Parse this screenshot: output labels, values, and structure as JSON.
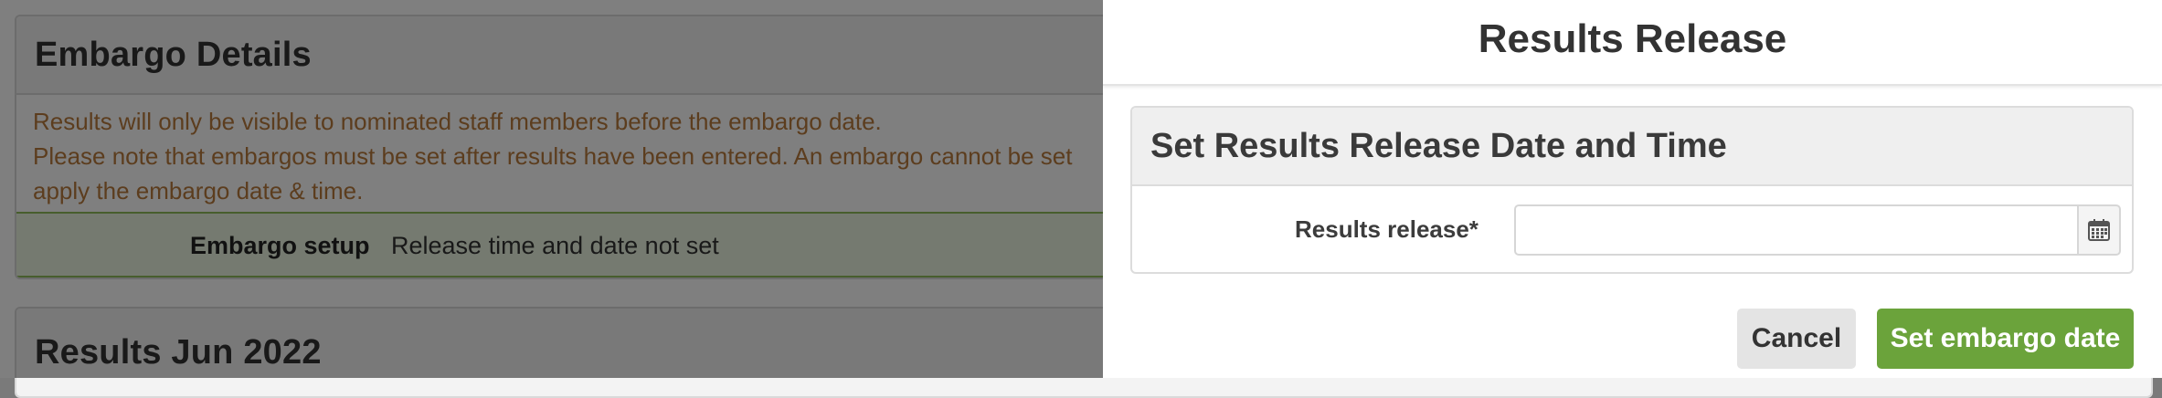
{
  "background_page": {
    "embargo_panel": {
      "title": "Embargo Details",
      "notice_lines": [
        "Results will only be visible to nominated staff members before the embargo date.",
        "Please note that embargos must be set after results have been entered. An embargo cannot be set",
        "apply the embargo date & time."
      ],
      "setup_label": "Embargo setup",
      "setup_value": "Release time and date not set"
    },
    "results_panel": {
      "title": "Results Jun 2022"
    }
  },
  "modal": {
    "title": "Results Release",
    "section_title": "Set Results Release Date and Time",
    "field_label": "Results release*",
    "date_value": "",
    "time_value": "",
    "calendar_icon": "calendar-icon",
    "cancel_label": "Cancel",
    "submit_label": "Set embargo date"
  },
  "colors": {
    "primary_button": "#6ba33b",
    "notice_text": "#b97a3c",
    "setup_row_border": "#8fbd5a"
  }
}
